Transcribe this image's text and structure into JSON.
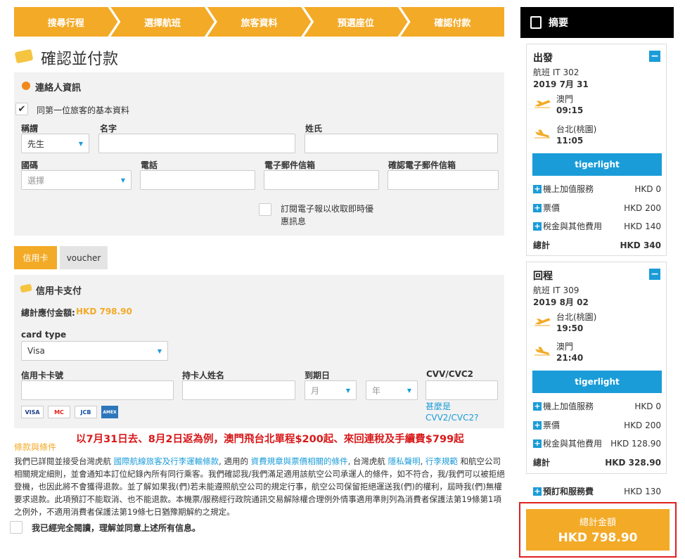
{
  "steps": [
    "搜尋行程",
    "選擇航班",
    "旅客資料",
    "預選座位",
    "確認付款"
  ],
  "page_title": "確認並付款",
  "contact": {
    "heading": "連絡人資訊",
    "same_as_first": "同第一位旅客的基本資料",
    "title_label": "稱謂",
    "title_value": "先生",
    "firstname_label": "名字",
    "lastname_label": "姓氏",
    "country_label": "國碼",
    "country_placeholder": "選擇",
    "phone_label": "電話",
    "email_label": "電子郵件信箱",
    "email_confirm_label": "確認電子郵件信箱",
    "newsletter_text": "訂閱電子報以收取即時優惠訊息"
  },
  "tabs": {
    "credit": "信用卡",
    "voucher": "voucher"
  },
  "payment": {
    "heading": "信用卡支付",
    "total_label": "總計應付金額:",
    "total_value": "HKD 798.90",
    "card_type_label": "card type",
    "card_type_value": "Visa",
    "card_no_label": "信用卡卡號",
    "holder_label": "持卡人姓名",
    "expiry_label": "到期日",
    "month_placeholder": "月",
    "year_placeholder": "年",
    "cvv_label": "CVV/CVC2",
    "cvv_help": "甚麼是CVV2/CVC2?",
    "card_logos": [
      "VISA",
      "MC",
      "JCB",
      "AMEX"
    ]
  },
  "red_note": "以7月31日去、8月2日返為例，澳門飛台北單程$200起、來回連稅及手續費$799起",
  "terms": {
    "label": "條款與條件",
    "p1": "我們已詳閱並接受台灣虎航 ",
    "l1": "國際航線旅客及行李運輸條款",
    "p2": ", 適用的 ",
    "l2": "資費規章與票價相關的條件",
    "p3": ", 台灣虎航 ",
    "l3": "隱私聲明",
    "p4": ", ",
    "l4": "行李規範",
    "p5": " 和航空公司相關規定細則，並會通知本訂位紀錄內所有同行乘客。我們確認我/我們滿足適用該航空公司承運人的條件，如不符合，我/我們可以被拒絕登機，也因此將不會獲得退款。並了解如果我(們)若未能遵照航空公司的規定行事，航空公司保留拒絕運送我(們)的權利，屆時我(們)無權要求退款。此項預訂不能取消、也不能退款。本機票/服務經行政院通訊交易解除權合理例外情事適用準則列為消費者保護法第19條第1項之例外，不適用消費者保護法第19條七日猶豫期解約之規定。",
    "agree": "我已經完全閱讀，理解並同意上述所有信息。"
  },
  "summary": {
    "heading": "摘要",
    "outbound": {
      "title": "出發",
      "flight": "航班 IT 302",
      "date": "2019 7月 31",
      "from": "澳門",
      "dep_time": "09:15",
      "to": "台北(桃園)",
      "arr_time": "11:05",
      "fare_brand": "tigerlight",
      "items": [
        {
          "label": "機上加值服務",
          "value": "HKD 0"
        },
        {
          "label": "票價",
          "value": "HKD 200"
        },
        {
          "label": "稅金與其他費用",
          "value": "HKD 140"
        }
      ],
      "total_label": "總計",
      "total_value": "HKD 340"
    },
    "return": {
      "title": "回程",
      "flight": "航班 IT 309",
      "date": "2019 8月 02",
      "from": "台北(桃園)",
      "dep_time": "19:50",
      "to": "澳門",
      "arr_time": "21:40",
      "fare_brand": "tigerlight",
      "items": [
        {
          "label": "機上加值服務",
          "value": "HKD 0"
        },
        {
          "label": "票價",
          "value": "HKD 200"
        },
        {
          "label": "稅金與其他費用",
          "value": "HKD 128.90"
        }
      ],
      "total_label": "總計",
      "total_value": "HKD 328.90"
    },
    "booking_fee_label": "預訂和服務費",
    "booking_fee_value": "HKD 130",
    "grand_total_label": "總計金額",
    "grand_total_value": "HKD 798.90"
  },
  "colors": {
    "accent": "#f3aa27",
    "blue": "#1a9cd8",
    "red": "#d8191a"
  }
}
